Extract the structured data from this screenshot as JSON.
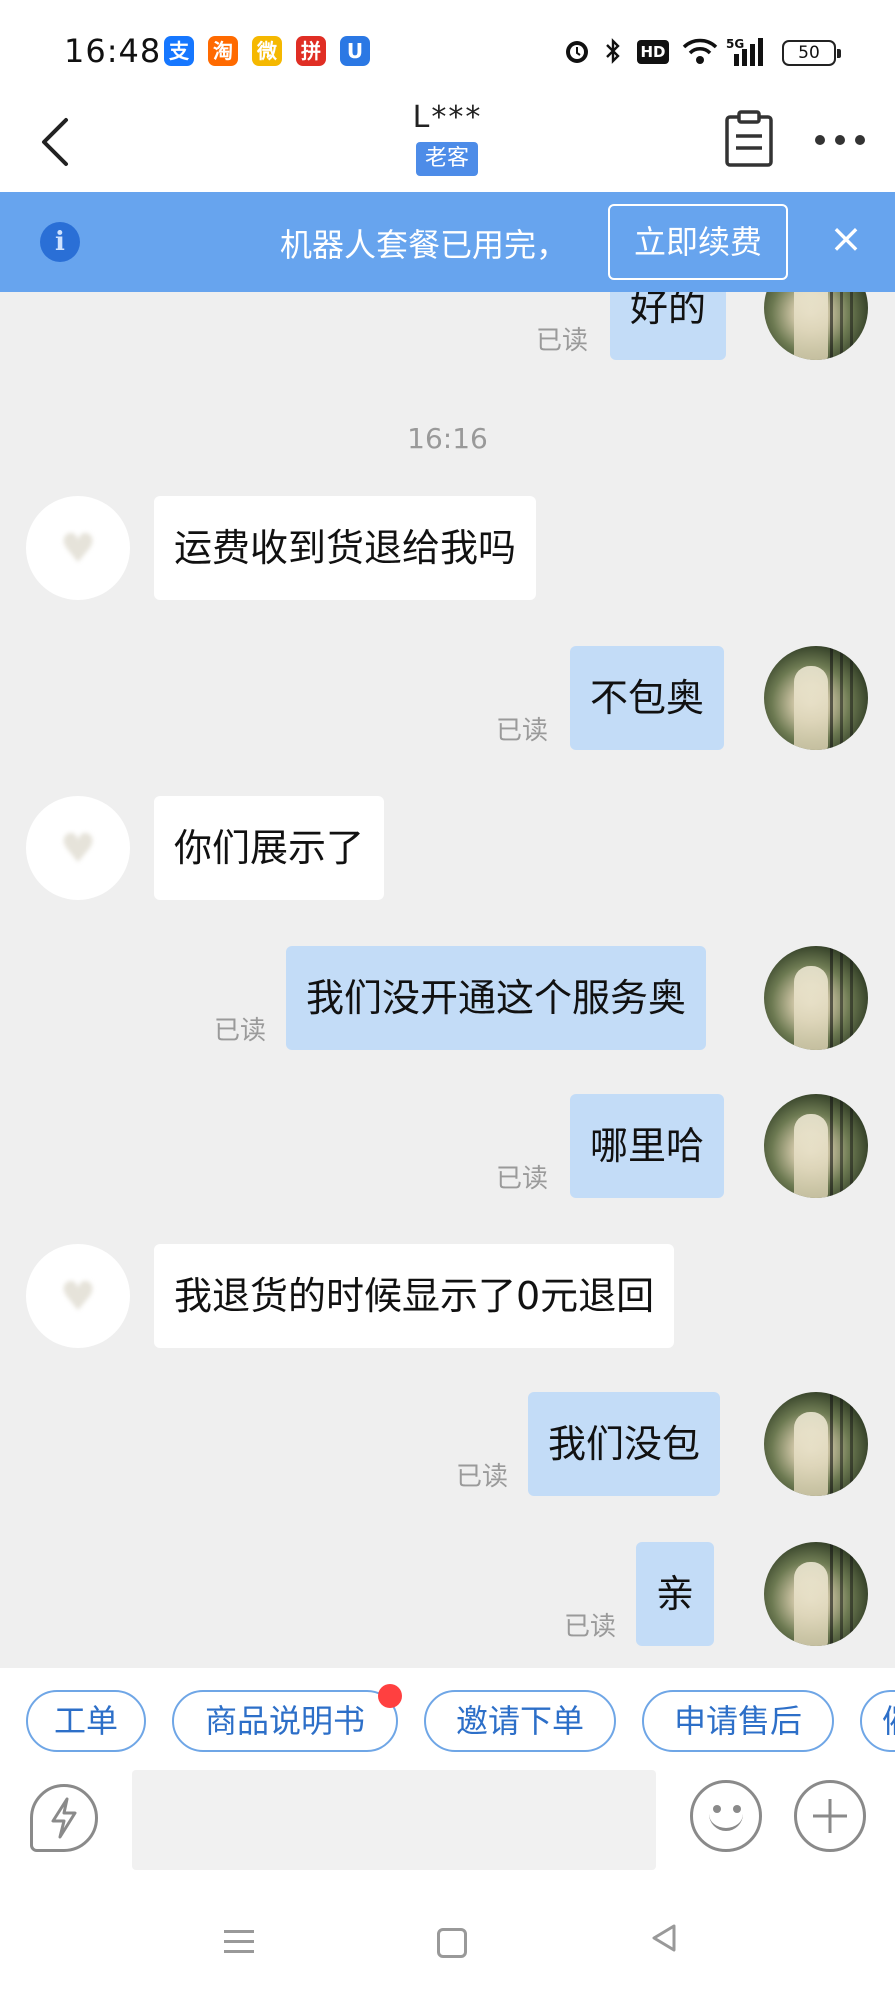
{
  "status_bar": {
    "time": "16:48",
    "apps": [
      {
        "icon": "alipay-icon",
        "glyph": "支",
        "color": "#1677ff"
      },
      {
        "icon": "taobao-icon",
        "glyph": "淘",
        "color": "#ff6a00"
      },
      {
        "icon": "weibo-icon",
        "glyph": "微",
        "color": "#f5b800"
      },
      {
        "icon": "pinduoduo-icon",
        "glyph": "拼",
        "color": "#e02e24"
      },
      {
        "icon": "shield-app-icon",
        "glyph": "U",
        "color": "#2b78e4"
      }
    ],
    "indicators": {
      "alarm": "alarm-icon",
      "bluetooth": "bluetooth-icon",
      "hd": "HD",
      "wifi": "wifi-icon",
      "network": "5G",
      "battery": "50"
    }
  },
  "header": {
    "title": "L***",
    "badge": "老客",
    "back_icon": "back-arrow-icon",
    "clipboard_icon": "clipboard-icon",
    "more_icon": "more-icon"
  },
  "banner": {
    "text": "机器人套餐已用完，",
    "button": "立即续费",
    "close": "×",
    "info": "i"
  },
  "chat": {
    "timestamp": "16:16",
    "read_label": "已读",
    "messages": [
      {
        "from": "self",
        "text": "好的",
        "read": true
      },
      {
        "from": "other",
        "text": "运费收到货退给我吗"
      },
      {
        "from": "self",
        "text": "不包奥",
        "read": true
      },
      {
        "from": "other",
        "text": "你们展示了"
      },
      {
        "from": "self",
        "text": "我们没开通这个服务奥",
        "read": true
      },
      {
        "from": "self",
        "text": "哪里哈",
        "read": true
      },
      {
        "from": "other",
        "text": "我退货的时候显示了0元退回"
      },
      {
        "from": "self",
        "text": "我们没包",
        "read": true
      },
      {
        "from": "self",
        "text": "亲",
        "read": true
      }
    ]
  },
  "quick_actions": [
    {
      "label": "工单",
      "dot": false
    },
    {
      "label": "商品说明书",
      "dot": true
    },
    {
      "label": "邀请下单",
      "dot": false
    },
    {
      "label": "申请售后",
      "dot": false
    },
    {
      "label": "催",
      "dot": false
    }
  ],
  "input": {
    "placeholder": "",
    "quick_reply_icon": "lightning-icon",
    "emoji_icon": "emoji-icon",
    "plus_icon": "plus-icon"
  },
  "nav": {
    "menu_icon": "menu-icon",
    "home_icon": "home-icon",
    "back_icon": "nav-back-icon"
  }
}
